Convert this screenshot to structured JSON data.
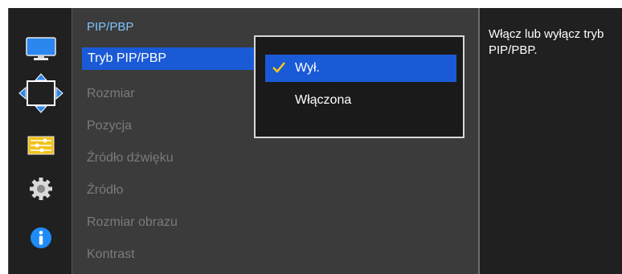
{
  "menu": {
    "title": "PIP/PBP",
    "items": [
      {
        "label": "Tryb PIP/PBP",
        "selected": true
      },
      {
        "label": "Rozmiar"
      },
      {
        "label": "Pozycja"
      },
      {
        "label": "Źródło dźwięku"
      },
      {
        "label": "Źródło"
      },
      {
        "label": "Rozmiar obrazu"
      },
      {
        "label": "Kontrast"
      }
    ]
  },
  "popup": {
    "options": [
      {
        "label": "Wył.",
        "checked": true
      },
      {
        "label": "Włączona",
        "checked": false
      }
    ]
  },
  "help": {
    "text": "Włącz lub wyłącz tryb PIP/PBP."
  },
  "sidebar": {
    "icons": [
      "monitor-icon",
      "move-arrows-icon",
      "sliders-icon",
      "gear-icon",
      "info-icon"
    ]
  },
  "colors": {
    "accent": "#1a5ad6",
    "title": "#7fc4ff",
    "check": "#ffc61a"
  }
}
